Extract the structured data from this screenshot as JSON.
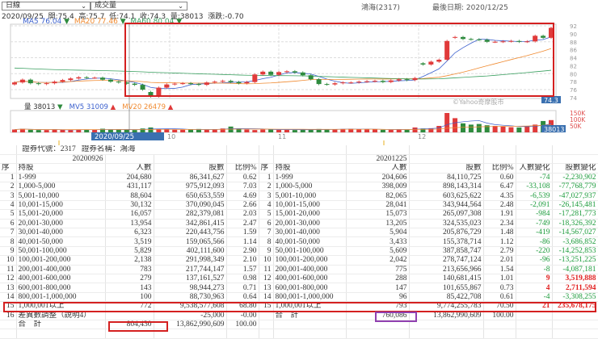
{
  "toolbar": {
    "period": "日線",
    "indicator": "成交量"
  },
  "stock": {
    "name_code": "鴻海(2317)",
    "last_date_label": "最後日期:",
    "last_date": "2020/12/25"
  },
  "quote": {
    "date": "2020/09/25",
    "open": "開:75.4",
    "high": "高:75.7",
    "low": "低:74.1",
    "close": "收:74.3",
    "volume": "量:38013",
    "change": "漲跌:-0.70"
  },
  "ma": {
    "ma5": "MA5 76.04",
    "ma20": "MA20 77.46",
    "ma60": "MA60 80.04"
  },
  "vol_legend": {
    "vol": "量 38013",
    "mv5": "MV5 31009",
    "mv20": "MV20 26479"
  },
  "price_axis": [
    "92",
    "90",
    "88",
    "86",
    "84",
    "82",
    "80",
    "78",
    "76",
    "74"
  ],
  "vol_axis": [
    "150K",
    "100K",
    "50K"
  ],
  "cursor": {
    "price": "74.3",
    "volume": "38013",
    "date": "2020/09/25"
  },
  "watermark": "©Yahoo奇摩股市",
  "x_labels": [
    "10",
    "11",
    "12"
  ],
  "colors": {
    "up": "#e03a3a",
    "down": "#2e8b3e",
    "ma5": "#3a5fcd",
    "ma20": "#f08a30",
    "ma60": "#3aa060",
    "highlight": "#d42020",
    "purple": "#9040b0"
  },
  "chart_data": {
    "type": "candlestick",
    "open": [
      77.3,
      77.8,
      78.5,
      77.6,
      77.4,
      77.6,
      78.0,
      78.4,
      78.8,
      79.1,
      79.0,
      79.0,
      78.5,
      78.0,
      77.8,
      77.5,
      77.2,
      75.4,
      74.3,
      76.5,
      77.3,
      77.5,
      77.6,
      77.4,
      77.2,
      77.8,
      78.0,
      78.2,
      77.9,
      77.6,
      77.9,
      79.8,
      80.5,
      79.7,
      80.4,
      80.6,
      80.3,
      79.6,
      78.6,
      77.4,
      77.3,
      77.6,
      77.8,
      77.8,
      78.0,
      78.1,
      78.2,
      77.9,
      78.3,
      78.6,
      78.4,
      82.6,
      82.3,
      83.0,
      83.5,
      89.0,
      89.2,
      88.7,
      88.6,
      88.5,
      88.0,
      88.0,
      88.1,
      88.2,
      88.0,
      88.1,
      89.5,
      89.0
    ],
    "close": [
      77.8,
      78.5,
      77.6,
      77.4,
      77.6,
      78.0,
      78.4,
      78.8,
      79.1,
      79.0,
      79.0,
      78.5,
      78.0,
      77.8,
      77.5,
      77.2,
      76.0,
      74.3,
      76.5,
      77.3,
      77.5,
      77.6,
      77.4,
      77.2,
      77.8,
      78.0,
      78.2,
      77.9,
      77.6,
      77.9,
      79.8,
      80.5,
      79.7,
      80.4,
      80.6,
      80.3,
      79.6,
      78.6,
      77.4,
      77.3,
      77.6,
      77.8,
      77.8,
      78.0,
      78.1,
      78.2,
      77.9,
      78.3,
      78.6,
      78.4,
      78.9,
      82.3,
      83.0,
      83.5,
      88.2,
      89.2,
      88.7,
      88.6,
      88.5,
      88.0,
      88.0,
      88.1,
      88.2,
      88.0,
      88.1,
      89.5,
      89.0,
      91.5
    ],
    "volume_k": [
      22,
      28,
      20,
      18,
      18,
      24,
      20,
      18,
      22,
      20,
      20,
      28,
      22,
      24,
      20,
      18,
      30,
      38,
      28,
      22,
      20,
      20,
      22,
      26,
      20,
      22,
      30,
      45,
      28,
      22,
      18,
      22,
      24,
      20,
      20,
      18,
      20,
      22,
      26,
      22,
      24,
      26,
      28,
      22,
      24,
      22,
      20,
      20,
      24,
      20,
      38,
      30,
      32,
      50,
      150,
      110,
      70,
      60,
      65,
      55,
      50,
      45,
      40,
      38,
      50,
      60,
      88,
      95
    ],
    "ylim": [
      74,
      92
    ]
  },
  "left_table": {
    "title_code": "證券代號：2317",
    "title_name": "證券名稱：鴻海",
    "date": "20200926",
    "headers": [
      "序",
      "持股",
      "人數",
      "股數",
      "比例%"
    ],
    "rows": [
      [
        "1",
        "1-999",
        "204,680",
        "86,341,627",
        "0.62"
      ],
      [
        "2",
        "1,000-5,000",
        "431,117",
        "975,912,093",
        "7.03"
      ],
      [
        "3",
        "5,001-10,000",
        "88,604",
        "650,653,559",
        "4.69"
      ],
      [
        "4",
        "10,001-15,000",
        "30,132",
        "370,090,045",
        "2.66"
      ],
      [
        "5",
        "15,001-20,000",
        "16,057",
        "282,379,081",
        "2.03"
      ],
      [
        "6",
        "20,001-30,000",
        "13,954",
        "342,861,415",
        "2.47"
      ],
      [
        "7",
        "30,001-40,000",
        "6,323",
        "220,443,756",
        "1.59"
      ],
      [
        "8",
        "40,001-50,000",
        "3,519",
        "159,065,566",
        "1.14"
      ],
      [
        "9",
        "50,001-100,000",
        "5,829",
        "402,111,600",
        "2.90"
      ],
      [
        "10",
        "100,001-200,000",
        "2,138",
        "291,998,349",
        "2.10"
      ],
      [
        "11",
        "200,001-400,000",
        "783",
        "217,744,147",
        "1.57"
      ],
      [
        "12",
        "400,001-600,000",
        "279",
        "137,161,527",
        "0.98"
      ],
      [
        "13",
        "600,001-800,000",
        "143",
        "98,944,273",
        "0.71"
      ],
      [
        "14",
        "800,001-1,000,000",
        "100",
        "88,730,963",
        "0.64"
      ],
      [
        "15",
        "1,000,001以上",
        "772",
        "9,538,577,608",
        "68.80"
      ],
      [
        "16",
        "差異數調整（說明4）",
        "",
        "-25,000",
        "-0.00"
      ]
    ],
    "total": {
      "label": "合　計",
      "people": "804,430",
      "shares": "13,862,990,609",
      "pct": "100.00"
    }
  },
  "right_table": {
    "date": "20201225",
    "headers": [
      "序",
      "持股",
      "人數",
      "股數",
      "比例%",
      "人數變化",
      "股數變化"
    ],
    "rows": [
      [
        "1",
        "1-999",
        "204,606",
        "84,110,725",
        "0.60",
        "-74",
        "-2,230,902"
      ],
      [
        "2",
        "1,000-5,000",
        "398,009",
        "898,143,314",
        "6.47",
        "-33,108",
        "-77,768,779"
      ],
      [
        "3",
        "5,001-10,000",
        "82,065",
        "603,625,622",
        "4.35",
        "-6,539",
        "-47,027,937"
      ],
      [
        "4",
        "10,001-15,000",
        "28,041",
        "343,944,564",
        "2.48",
        "-2,091",
        "-26,145,481"
      ],
      [
        "5",
        "15,001-20,000",
        "15,073",
        "265,097,308",
        "1.91",
        "-984",
        "-17,281,773"
      ],
      [
        "6",
        "20,001-30,000",
        "13,205",
        "324,535,023",
        "2.34",
        "-749",
        "-18,326,392"
      ],
      [
        "7",
        "30,001-40,000",
        "5,904",
        "205,876,729",
        "1.48",
        "-419",
        "-14,567,027"
      ],
      [
        "8",
        "40,001-50,000",
        "3,433",
        "155,378,714",
        "1.12",
        "-86",
        "-3,686,852"
      ],
      [
        "9",
        "50,001-100,000",
        "5,609",
        "387,858,747",
        "2.79",
        "-220",
        "-14,252,853"
      ],
      [
        "10",
        "100,001-200,000",
        "2,042",
        "278,747,124",
        "2.01",
        "-96",
        "-13,251,225"
      ],
      [
        "11",
        "200,001-400,000",
        "775",
        "213,656,966",
        "1.54",
        "-8",
        "-4,087,181"
      ],
      [
        "12",
        "400,001-600,000",
        "288",
        "140,681,415",
        "1.01",
        "9",
        "3,519,888"
      ],
      [
        "13",
        "600,001-800,000",
        "147",
        "101,655,867",
        "0.73",
        "4",
        "2,711,594"
      ],
      [
        "14",
        "800,001-1,000,000",
        "96",
        "85,422,708",
        "0.61",
        "-4",
        "-3,308,255"
      ],
      [
        "15",
        "1,000,001以上",
        "793",
        "9,774,255,783",
        "70.50",
        "21",
        "235,678,175"
      ]
    ],
    "total": {
      "label": "合　計",
      "people": "760,086",
      "shares": "13,862,990,609",
      "pct": "100.00"
    }
  }
}
